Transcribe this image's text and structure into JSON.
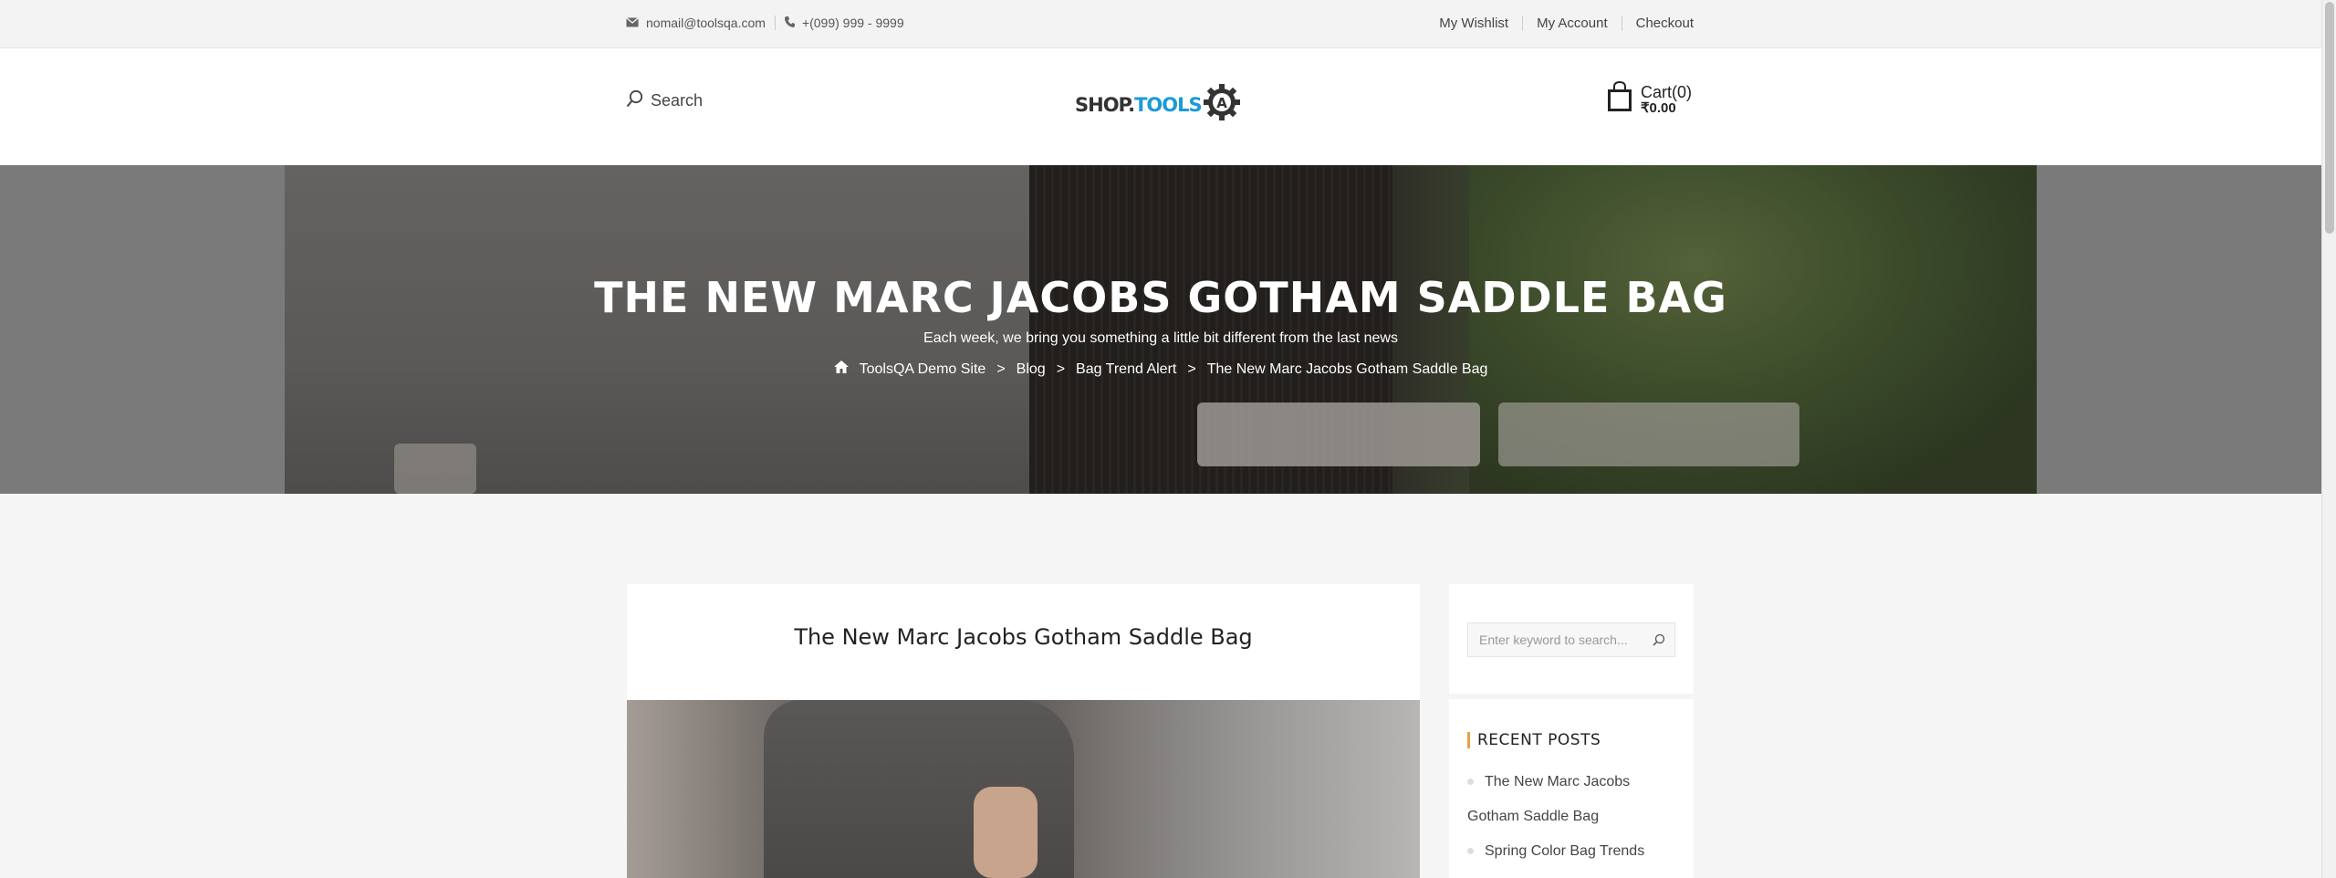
{
  "topbar": {
    "email": "nomail@toolsqa.com",
    "phone": "+(099) 999 - 9999",
    "links": [
      "My Wishlist",
      "My Account",
      "Checkout"
    ]
  },
  "header": {
    "search_label": "Search",
    "logo_part1": "SHOP.",
    "logo_part2": "TOOLS",
    "cart_label": "Cart(0)",
    "cart_amount": "₹0.00"
  },
  "hero": {
    "title": "THE NEW MARC JACOBS GOTHAM SADDLE BAG",
    "subtitle": "Each week, we bring you something a little bit different from the last news",
    "breadcrumbs": [
      "ToolsQA Demo Site",
      "Blog",
      "Bag Trend Alert",
      "The New Marc Jacobs Gotham Saddle Bag"
    ],
    "separator": ">"
  },
  "post": {
    "title": "The New Marc Jacobs Gotham Saddle Bag"
  },
  "sidebar": {
    "search_placeholder": "Enter keyword to search...",
    "recent_posts_heading": "RECENT POSTS",
    "recent_posts": [
      {
        "line1": "The New Marc Jacobs",
        "line2": "Gotham Saddle Bag"
      },
      {
        "line1": "Spring Color Bag Trends"
      }
    ]
  },
  "colors": {
    "accent": "#e6a23c",
    "logo_blue": "#1c9ad6"
  }
}
